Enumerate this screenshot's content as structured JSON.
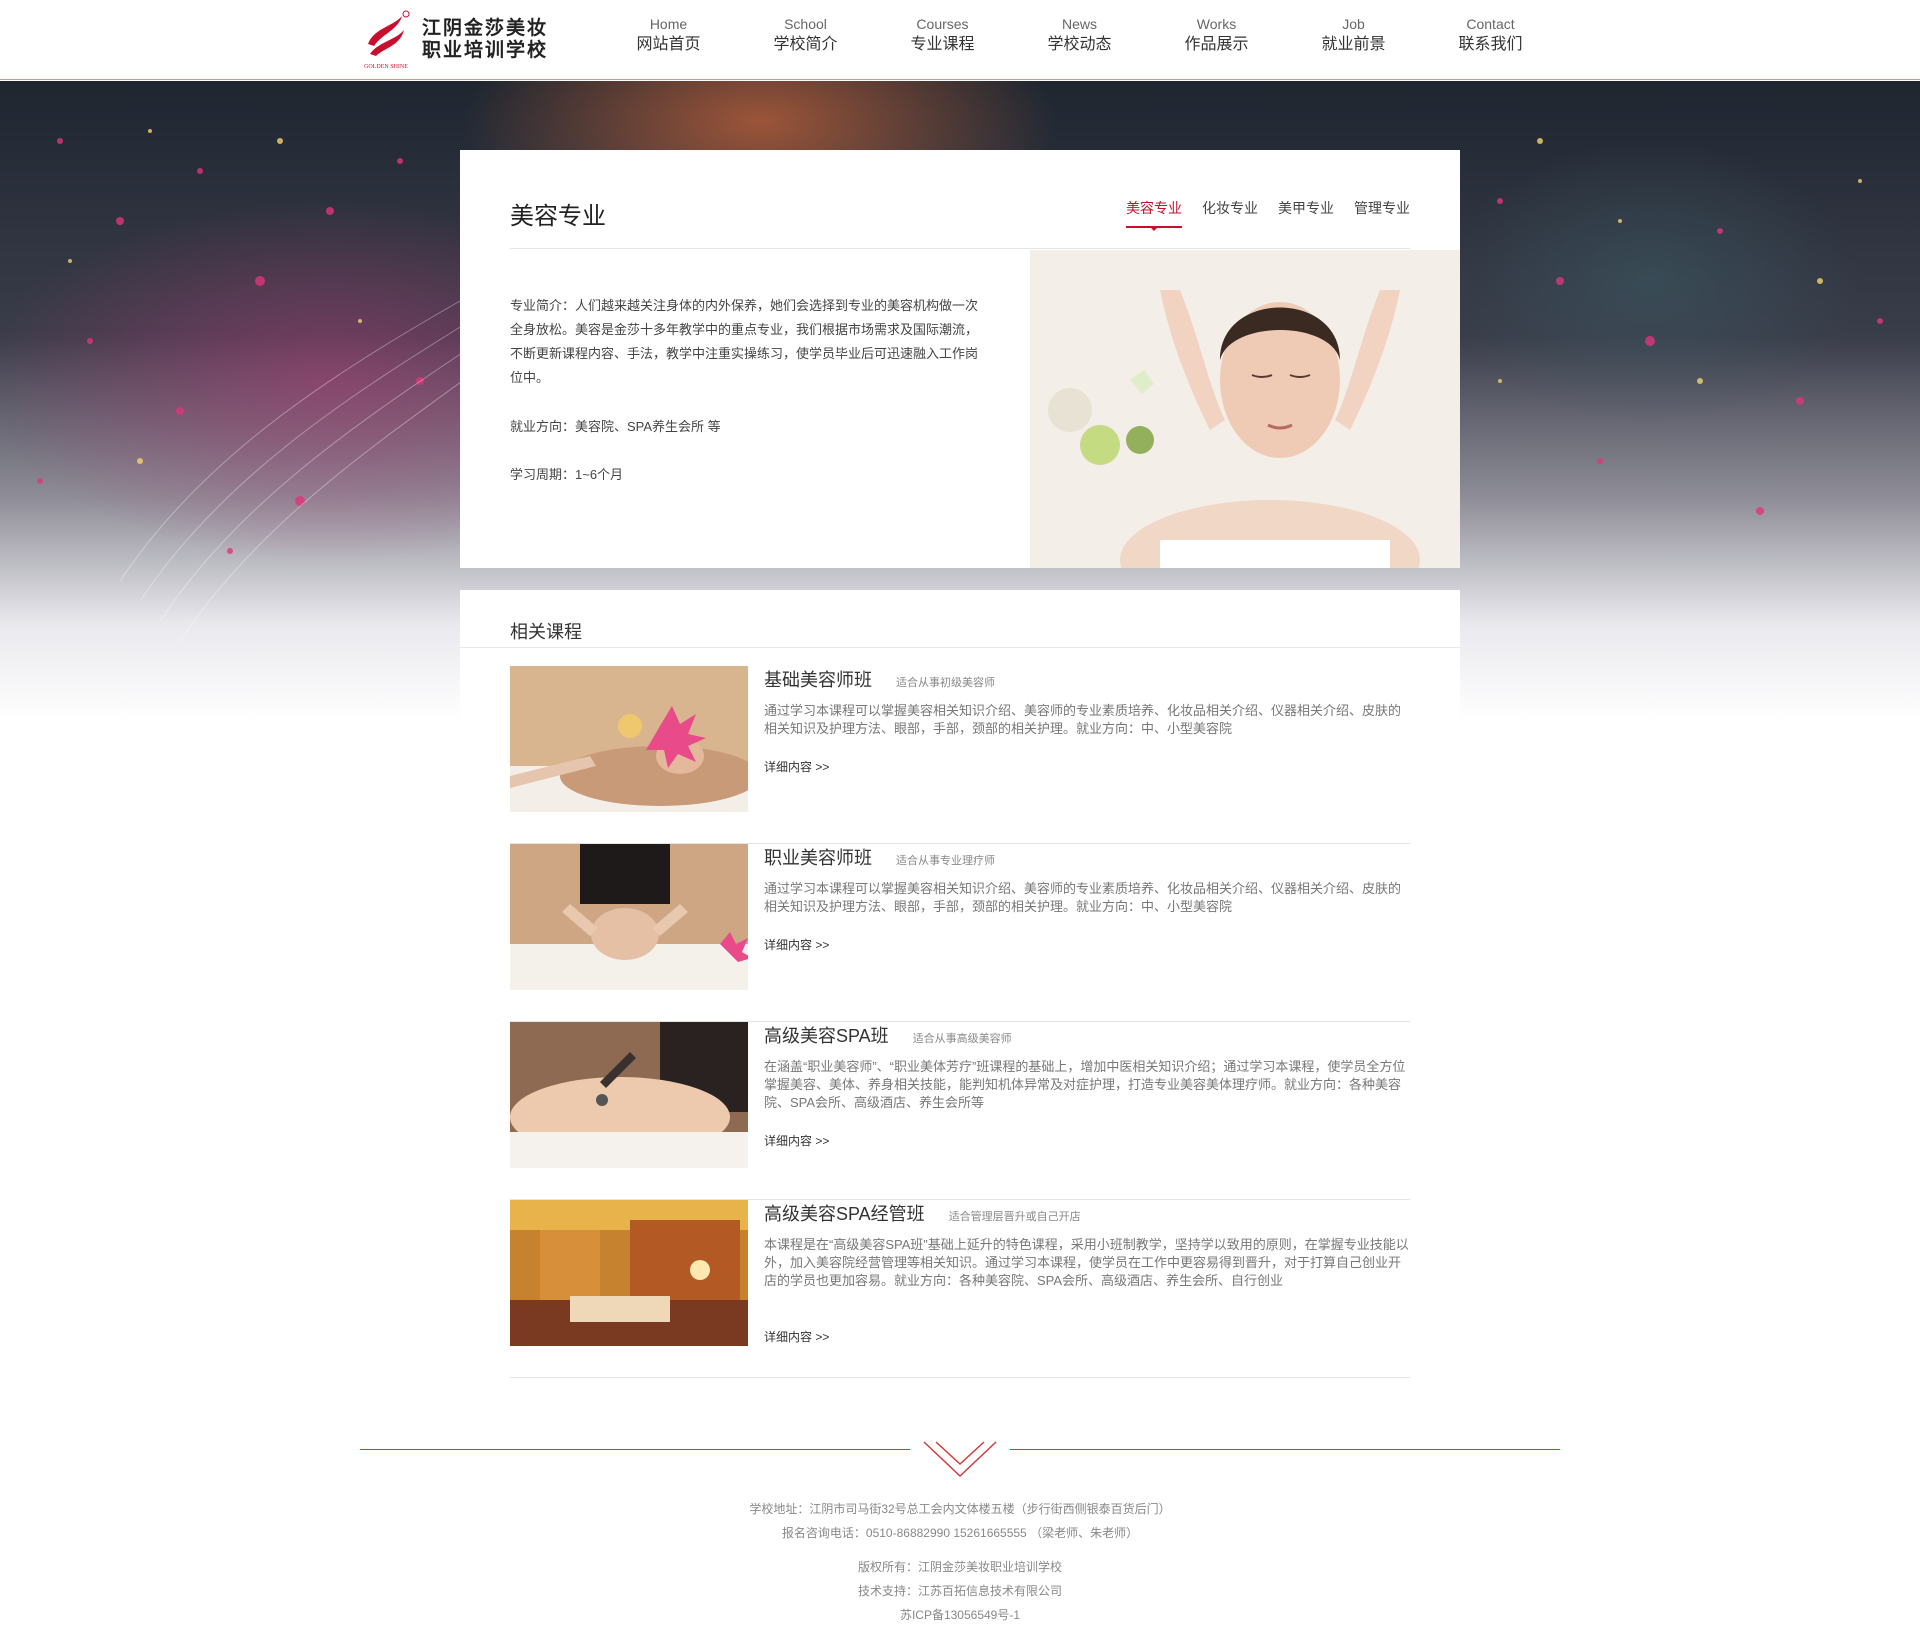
{
  "header": {
    "logo_line1": "江阴金莎美妆",
    "logo_line2": "职业培训学校",
    "logo_brand": "GOLDEN SHINE",
    "nav": [
      {
        "en": "Home",
        "cn": "网站首页"
      },
      {
        "en": "School",
        "cn": "学校简介"
      },
      {
        "en": "Courses",
        "cn": "专业课程"
      },
      {
        "en": "News",
        "cn": "学校动态"
      },
      {
        "en": "Works",
        "cn": "作品展示"
      },
      {
        "en": "Job",
        "cn": "就业前景"
      },
      {
        "en": "Contact",
        "cn": "联系我们"
      }
    ]
  },
  "major": {
    "title": "美容专业",
    "tabs": [
      "美容专业",
      "化妆专业",
      "美甲专业",
      "管理专业"
    ],
    "active_tab": "美容专业",
    "intro": "专业简介：人们越来越关注身体的内外保养，她们会选择到专业的美容机构做一次全身放松。美容是金莎十多年教学中的重点专业，我们根据市场需求及国际潮流，不断更新课程内容、手法，教学中注重实操练习，使学员毕业后可迅速融入工作岗位中。",
    "direction": "就业方向：美容院、SPA养生会所 等",
    "period": "学习周期：1~6个月"
  },
  "related": {
    "title": "相关课程",
    "more_label": "详细内容  >>",
    "courses": [
      {
        "title": "基础美容师班",
        "subtitle": "适合从事初级美容师",
        "desc": "通过学习本课程可以掌握美容相关知识介绍、美容师的专业素质培养、化妆品相关介绍、仪器相关介绍、皮肤的相关知识及护理方法、眼部，手部，颈部的相关护理。就业方向：中、小型美容院"
      },
      {
        "title": "职业美容师班",
        "subtitle": "适合从事专业理疗师",
        "desc": "通过学习本课程可以掌握美容相关知识介绍、美容师的专业素质培养、化妆品相关介绍、仪器相关介绍、皮肤的相关知识及护理方法、眼部，手部，颈部的相关护理。就业方向：中、小型美容院"
      },
      {
        "title": "高级美容SPA班",
        "subtitle": "适合从事高级美容师",
        "desc": "在涵盖“职业美容师”、“职业美体芳疗”班课程的基础上，增加中医相关知识介绍；通过学习本课程，使学员全方位掌握美容、美体、养身相关技能，能判知机体异常及对症护理，打造专业美容美体理疗师。就业方向：各种美容院、SPA会所、高级酒店、养生会所等"
      },
      {
        "title": "高级美容SPA经管班",
        "subtitle": "适合管理层晋升或自己开店",
        "desc": "本课程是在“高级美容SPA班”基础上延升的特色课程，采用小班制教学，坚持学以致用的原则，在掌握专业技能以外，加入美容院经营管理等相关知识。通过学习本课程，使学员在工作中更容易得到晋升，对于打算自己创业开店的学员也更加容易。就业方向：各种美容院、SPA会所、高级酒店、养生会所、自行创业"
      }
    ]
  },
  "footer": {
    "address": "学校地址：江阴市司马街32号总工会内文体楼五楼（步行街西侧银泰百货后门）",
    "phone": "报名咨询电话：0510-86882990  15261665555 （梁老师、朱老师）",
    "copyright": "版权所有：江阴金莎美妆职业培训学校",
    "support": "技术支持：江苏百拓信息技术有限公司",
    "icp": "苏ICP备13056549号-1"
  },
  "colors": {
    "accent": "#c8102e",
    "footer_line": "#d23a3a"
  }
}
